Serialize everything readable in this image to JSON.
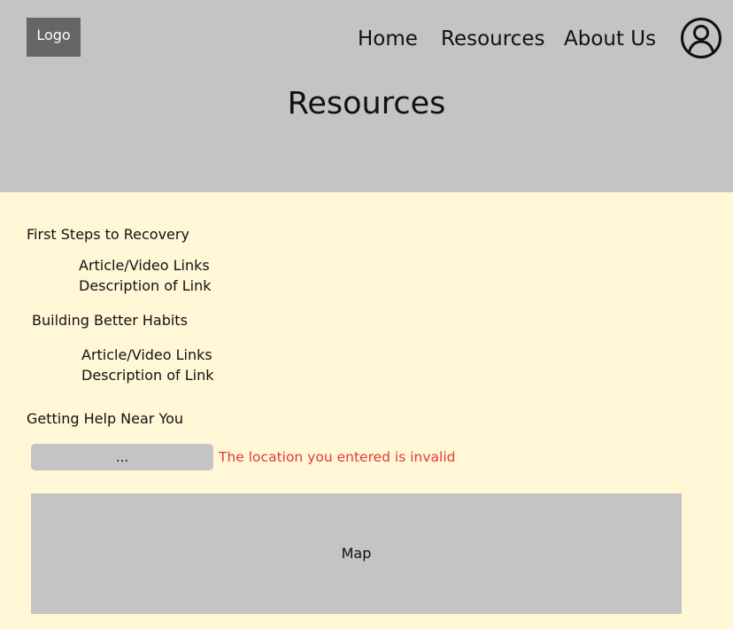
{
  "header": {
    "logo_text": "Logo",
    "nav": {
      "home": "Home",
      "resources": "Resources",
      "about": "About Us"
    },
    "profile_icon": "user-circle-icon",
    "title": "Resources"
  },
  "sections": [
    {
      "heading": "First Steps to Recovery",
      "link_text": "Article/Video Links",
      "description": "Description of Link"
    },
    {
      "heading": "Building Better Habits",
      "link_text": "Article/Video Links",
      "description": "Description of Link"
    },
    {
      "heading": "Getting Help Near You"
    }
  ],
  "location": {
    "placeholder": "...",
    "error": "The location you entered is invalid"
  },
  "map": {
    "label": "Map"
  },
  "colors": {
    "header_bg": "#c4c4c4",
    "page_bg": "#fff7d6",
    "logo_bg": "#666666",
    "error": "#e23b35"
  }
}
